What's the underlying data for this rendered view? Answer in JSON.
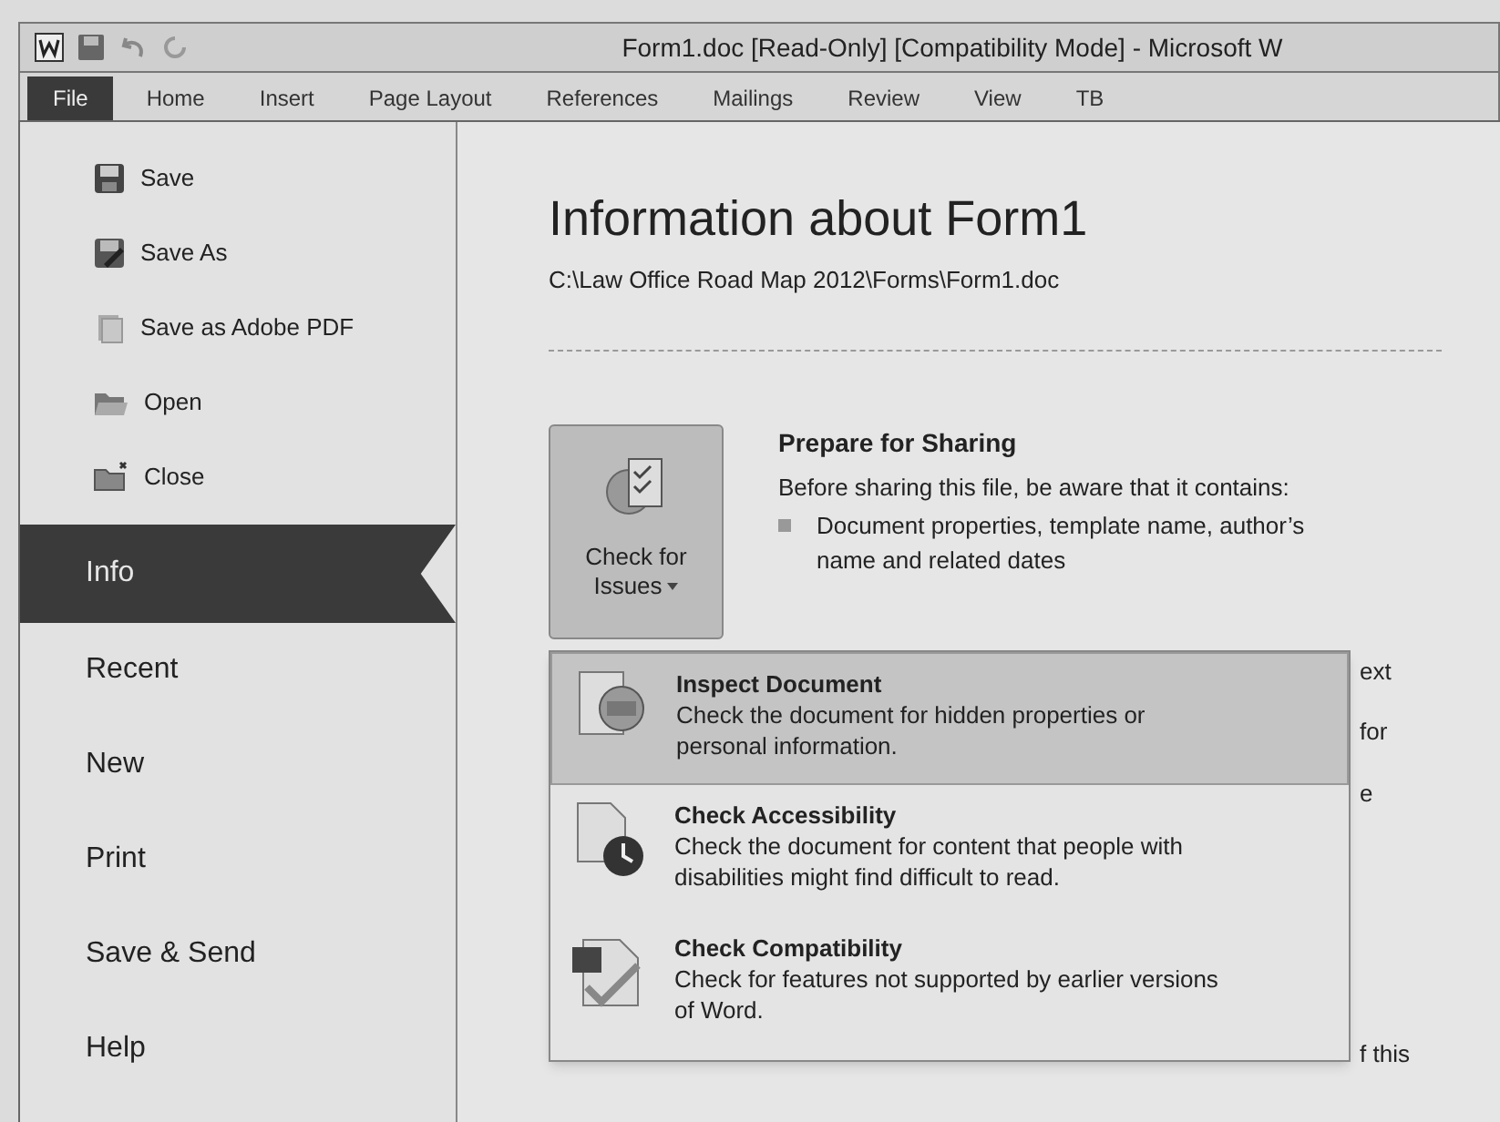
{
  "window": {
    "title": "Form1.doc [Read-Only] [Compatibility Mode] - Microsoft W"
  },
  "ribbon_tabs": [
    {
      "label": "File",
      "selected": true
    },
    {
      "label": "Home",
      "selected": false
    },
    {
      "label": "Insert",
      "selected": false
    },
    {
      "label": "Page Layout",
      "selected": false
    },
    {
      "label": "References",
      "selected": false
    },
    {
      "label": "Mailings",
      "selected": false
    },
    {
      "label": "Review",
      "selected": false
    },
    {
      "label": "View",
      "selected": false
    },
    {
      "label": "TB",
      "selected": false
    }
  ],
  "backstage_commands": [
    {
      "label": "Save",
      "kind": "save"
    },
    {
      "label": "Save As",
      "kind": "saveas"
    },
    {
      "label": "Save as Adobe PDF",
      "kind": "pdf"
    },
    {
      "label": "Open",
      "kind": "open"
    },
    {
      "label": "Close",
      "kind": "close"
    }
  ],
  "backstage_tabs": [
    {
      "label": "Info",
      "selected": true
    },
    {
      "label": "Recent",
      "selected": false
    },
    {
      "label": "New",
      "selected": false
    },
    {
      "label": "Print",
      "selected": false
    },
    {
      "label": "Save & Send",
      "selected": false
    },
    {
      "label": "Help",
      "selected": false
    }
  ],
  "info": {
    "title": "Information about Form1",
    "path": "C:\\Law Office Road Map 2012\\Forms\\Form1.doc",
    "check_button": {
      "label_line_1": "Check for",
      "label_line_2": "Issues"
    },
    "section_heading": "Prepare for Sharing",
    "section_text": "Before sharing this file, be aware that it contains:",
    "bullets": [
      "Document properties, template name, author’s name and related dates"
    ],
    "covered_fragments": [
      "ext",
      "for",
      "e",
      "f this"
    ]
  },
  "issues_menu": [
    {
      "title": "Inspect Document",
      "description": "Check the document for hidden properties or personal information.",
      "kind": "inspect",
      "selected": true
    },
    {
      "title": "Check Accessibility",
      "description": "Check the document for content that people with disabilities might find difficult to read.",
      "kind": "accessibility",
      "selected": false
    },
    {
      "title": "Check Compatibility",
      "description": "Check for features not supported by earlier versions of Word.",
      "kind": "compatibility",
      "selected": false
    }
  ]
}
